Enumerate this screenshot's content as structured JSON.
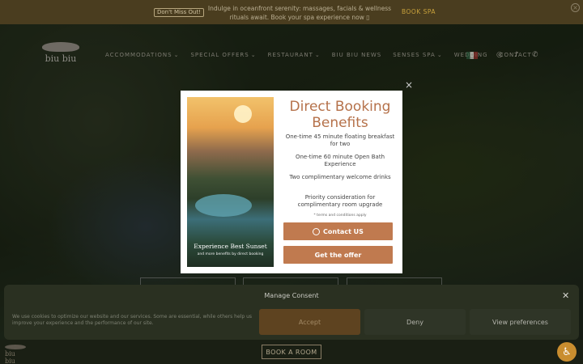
{
  "announcement": {
    "badge": "Don't Miss Out!",
    "message": "Indulge in oceanfront serenity: massages, facials & wellness rituals await. Book your spa experience now ▯",
    "cta": "BOOK SPA",
    "close": "×"
  },
  "logo": {
    "text": "biu biu"
  },
  "nav": {
    "items": [
      {
        "label": "ACCOMMODATIONS",
        "dropdown": "⌄"
      },
      {
        "label": "SPECIAL OFFERS",
        "dropdown": "⌄"
      },
      {
        "label": "RESTAURANT",
        "dropdown": "⌄"
      },
      {
        "label": "BIU BIU NEWS",
        "dropdown": ""
      },
      {
        "label": "SENSES SPA",
        "dropdown": "⌄"
      },
      {
        "label": "WEDDING",
        "dropdown": ""
      },
      {
        "label": "CONTACT",
        "dropdown": ""
      }
    ]
  },
  "popup": {
    "close": "×",
    "title": "Direct Booking Benefits",
    "image_caption": "Experience Best Sunset",
    "image_subcaption": "and more benefits by direct booking",
    "benefits": [
      "One-time 45 minute floating breakfast for two",
      "One-time 60 minute Open Bath Experience",
      "Two complimentary welcome drinks",
      "Priority consideration for complimentary room upgrade"
    ],
    "terms": "* terms and conditions apply",
    "contact_label": "Contact US",
    "offer_label": "Get the offer"
  },
  "consent": {
    "title": "Manage Consent",
    "close": "✕",
    "text": "We use cookies to optimize our website and our services. Some are essential, while others help us improve your experience and the performance of our site.",
    "accept": "Accept",
    "deny": "Deny",
    "preferences": "View preferences"
  },
  "footer": {
    "logo_text": "biu biu",
    "book_room": "BOOK A ROOM",
    "accessibility_icon": "♿"
  },
  "colors": {
    "accent": "#c07a4f",
    "title": "#b5714a",
    "announce_bg": "#4a3d1f",
    "consent_bg": "#2a3021",
    "a11y": "#c98d2f"
  }
}
